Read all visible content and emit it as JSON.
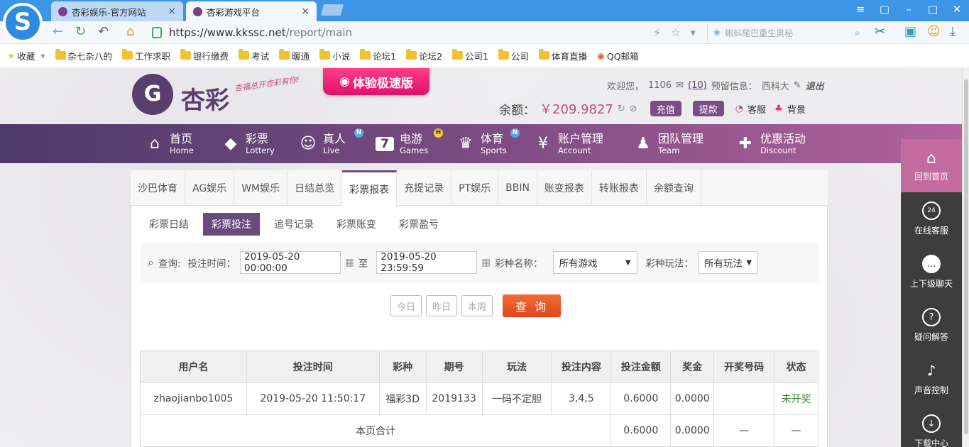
{
  "browser": {
    "tabs": [
      {
        "title": "杏彩娱乐-官方网站",
        "close": "×"
      },
      {
        "title": "杏彩游戏平台",
        "close": "×"
      }
    ],
    "logo_letter": "S",
    "url_host": "https://www.kkssc.net",
    "url_path": "/report/main",
    "search_placeholder": "蝌蚪尾巴重生奥秘",
    "bookmarks": [
      "收藏",
      "杂七杂八的",
      "工作求职",
      "银行缴费",
      "考试",
      "暖通",
      "小说",
      "论坛1",
      "论坛2",
      "公司1",
      "公司",
      "体育直播",
      "QQ邮箱"
    ]
  },
  "header": {
    "logo_glyph": "G",
    "site_name": "杏彩",
    "slogan": "杏福总开杏彩有你!",
    "promo": "体验极速版",
    "welcome_label": "欢迎您，",
    "username": "1106",
    "mail_count": "(10)",
    "reserve_label": "预留信息：",
    "reserve_value": "西科大",
    "logout": "退出",
    "balance_label": "余额：",
    "balance_value": "￥209.9827",
    "recharge": "充值",
    "withdraw": "提款",
    "service": "客服",
    "background": "背景"
  },
  "nav": [
    {
      "cn": "首页",
      "en": "Home",
      "icon": "⌂"
    },
    {
      "cn": "彩票",
      "en": "Lottery",
      "icon": "◆"
    },
    {
      "cn": "真人",
      "en": "Live",
      "icon": "☺",
      "badge": "N"
    },
    {
      "cn": "电游",
      "en": "Games",
      "icon": "7",
      "badge": "H"
    },
    {
      "cn": "体育",
      "en": "Sports",
      "icon": "♛",
      "badge": "N"
    },
    {
      "cn": "账户管理",
      "en": "Account",
      "icon": "¥"
    },
    {
      "cn": "团队管理",
      "en": "Team",
      "icon": "♟"
    },
    {
      "cn": "优惠活动",
      "en": "Discount",
      "icon": "✚"
    }
  ],
  "report_tabs": [
    "沙巴体育",
    "AG娱乐",
    "WM娱乐",
    "日结总览",
    "彩票报表",
    "充提记录",
    "PT娱乐",
    "BBIN",
    "账变报表",
    "转账报表",
    "余额查询"
  ],
  "active_report_tab": "彩票报表",
  "sub_tabs": [
    "彩票日结",
    "彩票投注",
    "追号记录",
    "彩票账变",
    "彩票盈亏"
  ],
  "active_sub_tab": "彩票投注",
  "filter": {
    "query_label": "查询:",
    "time_label": "投注时间：",
    "start": "2019-05-20 00:00:00",
    "to": "至",
    "end": "2019-05-20 23:59:59",
    "game_label": "彩种名称：",
    "game_value": "所有游戏",
    "play_label": "彩种玩法：",
    "play_value": "所有玩法",
    "today": "今日",
    "yesterday": "昨日",
    "week": "本周",
    "query_button": "查 询"
  },
  "table": {
    "headers": [
      "用户名",
      "投注时间",
      "彩种",
      "期号",
      "玩法",
      "投注内容",
      "投注金额",
      "奖金",
      "开奖号码",
      "状态"
    ],
    "rows": [
      [
        "zhaojianbo1005",
        "2019-05-20 11:50:17",
        "福彩3D",
        "2019133",
        "一码不定胆",
        "3,4,5",
        "0.6000",
        "0.0000",
        "",
        "未开奖"
      ]
    ],
    "summary": {
      "label": "本页合计",
      "amount": "0.6000",
      "bonus": "0.0000",
      "draw": "—",
      "status": "—"
    }
  },
  "sidebar": [
    {
      "label": "回到首页",
      "icon": "⌂"
    },
    {
      "label": "在线客服",
      "icon": "24"
    },
    {
      "label": "上下级聊天",
      "icon": "…"
    },
    {
      "label": "疑问解答",
      "icon": "?"
    },
    {
      "label": "声音控制",
      "icon": "♪"
    },
    {
      "label": "下载中心",
      "icon": "↓"
    }
  ]
}
